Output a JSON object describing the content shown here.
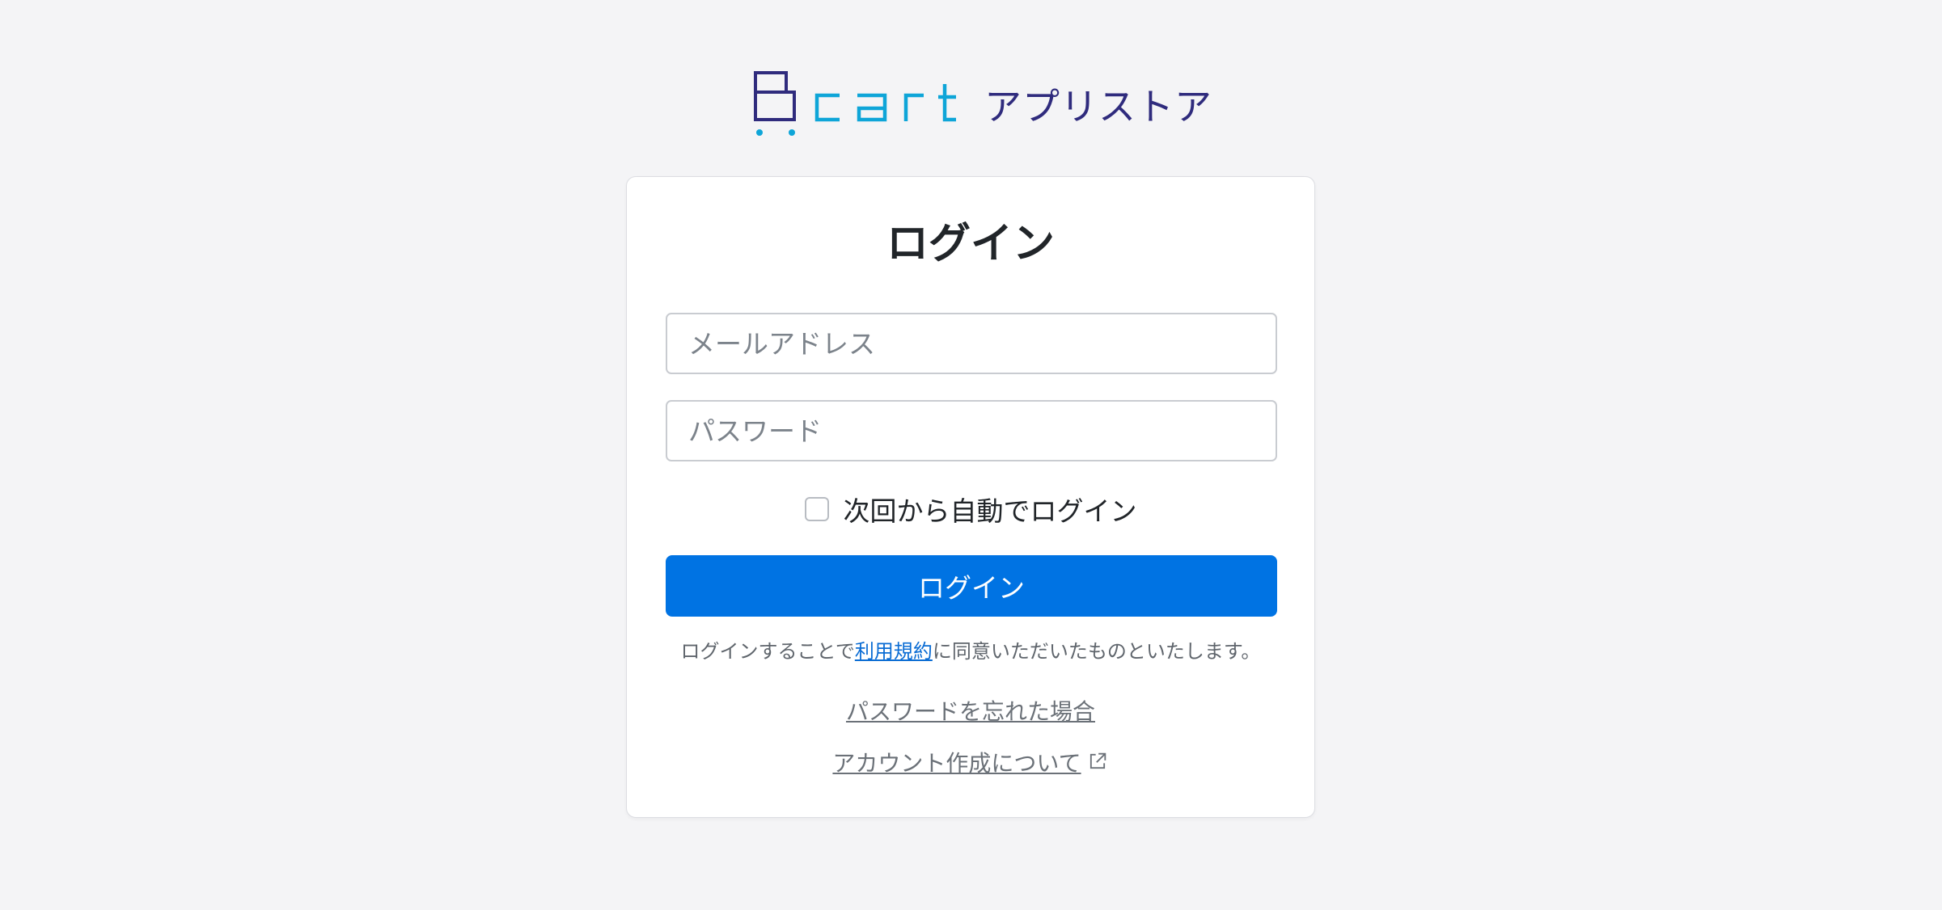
{
  "brand": {
    "wordmark": "cart",
    "suffix": "アプリストア",
    "logo_icon": "b-cart-icon",
    "colors": {
      "navy": "#2f2b7d",
      "cyan": "#0ea5d8"
    }
  },
  "login": {
    "title": "ログイン",
    "email_placeholder": "メールアドレス",
    "password_placeholder": "パスワード",
    "remember_label": "次回から自動でログイン",
    "remember_checked": false,
    "submit_label": "ログイン",
    "terms_prefix": "ログインすることで",
    "terms_link": "利用規約",
    "terms_suffix": "に同意いただいたものといたします。",
    "forgot_password": "パスワードを忘れた場合",
    "account_info": "アカウント作成について",
    "account_info_icon": "external-link-icon",
    "colors": {
      "primary": "#0073e3",
      "link": "#0a6cd4"
    }
  }
}
